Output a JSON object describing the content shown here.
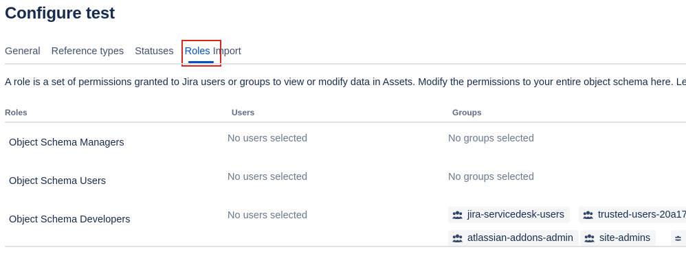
{
  "page_title": "Configure test",
  "tabs": [
    {
      "label": "General"
    },
    {
      "label": "Reference types"
    },
    {
      "label": "Statuses"
    },
    {
      "label": "Roles",
      "active": true
    },
    {
      "label": "Import"
    }
  ],
  "description": "A role is a set of permissions granted to Jira users or groups to view or modify data in Assets. Modify the permissions to your entire object schema here. Lea",
  "table": {
    "headers": {
      "roles": "Roles",
      "users": "Users",
      "groups": "Groups"
    },
    "rows": [
      {
        "role": "Object Schema Managers",
        "users": "No users selected",
        "groups": "No groups selected"
      },
      {
        "role": "Object Schema Users",
        "users": "No users selected",
        "groups": "No groups selected"
      },
      {
        "role": "Object Schema Developers",
        "users": "No users selected",
        "group_tags": [
          "jira-servicedesk-users",
          "trusted-users-20a17",
          "atlassian-addons-admin",
          "site-admins",
          ""
        ]
      }
    ]
  },
  "colors": {
    "accent": "#0052cc",
    "highlight": "#e0241b",
    "text": "#172b4d",
    "muted": "#6b778c"
  },
  "icons": {
    "group": "group-icon"
  }
}
